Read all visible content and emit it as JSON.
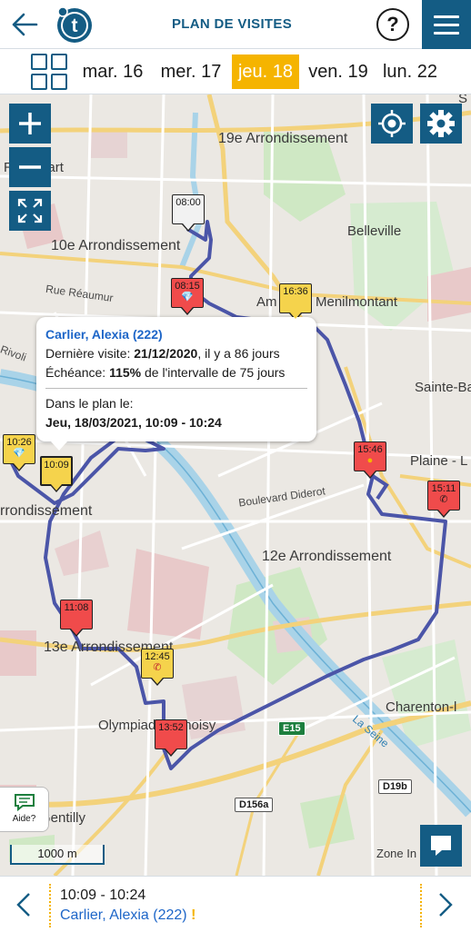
{
  "header": {
    "title": "PLAN DE VISITES",
    "help_label": "?",
    "logo_letter": "t"
  },
  "days": [
    {
      "label": "mar. 16",
      "active": false
    },
    {
      "label": "mer. 17",
      "active": false
    },
    {
      "label": "jeu. 18",
      "active": true
    },
    {
      "label": "ven. 19",
      "active": false
    },
    {
      "label": "lun. 22",
      "active": false
    }
  ],
  "map": {
    "places": {
      "p19e": "19e Arrondissement",
      "p10e": "10e Arrondissement",
      "belleville": "Belleville",
      "menilmontant": "Am  ers - Menilmontant",
      "reaumur": "Rue Réaumur",
      "sainte": "Sainte-Ba",
      "plaine": "Plaine - L",
      "rrond": "rrondissement",
      "diderot": "Boulevard Diderot",
      "p12e": "12e Arrondissement",
      "p13e": "13e Arrondissement",
      "olympiades": "Olympiades Choisy",
      "charenton": "Charenton-l",
      "seine": "La Seine",
      "gentilly": "Gentilly",
      "zone": "Zone In",
      "chouart": "R   houart",
      "rivoli": "Rivoli",
      "s_top": "S"
    },
    "shields": {
      "e15": "E15",
      "d19b": "D19b",
      "d156a": "D156a"
    },
    "markers": [
      {
        "time": "08:00",
        "color": "grey",
        "icon": ""
      },
      {
        "time": "08:15",
        "color": "red",
        "icon": "💎"
      },
      {
        "time": "16:36",
        "color": "yellow",
        "icon": ""
      },
      {
        "time": "15:46",
        "color": "red",
        "icon": "●"
      },
      {
        "time": "15:11",
        "color": "red",
        "icon": "✆"
      },
      {
        "time": "10:26",
        "color": "yellow",
        "icon": "💎"
      },
      {
        "time": "10:09",
        "color": "yellow",
        "icon": ""
      },
      {
        "time": "11:08",
        "color": "red",
        "icon": ""
      },
      {
        "time": "12:45",
        "color": "yellow",
        "icon": "✆"
      },
      {
        "time": "13:52",
        "color": "red",
        "icon": ""
      }
    ],
    "popup": {
      "name": "Carlier, Alexia (222)",
      "last_visit_label": "Dernière visite:",
      "last_visit_date": "21/12/2020",
      "last_visit_suffix": ", il y a 86 jours",
      "due_label": "Échéance:",
      "due_percent": "115%",
      "due_suffix": "de l'intervalle de 75 jours",
      "plan_label": "Dans le plan le:",
      "plan_value": "Jeu, 18/03/2021, 10:09 - 10:24"
    },
    "aide_label": "Aide?",
    "scale_label": "1000 m"
  },
  "footer": {
    "time": "10:09 - 10:24",
    "client": "Carlier, Alexia (222)",
    "warn": "!"
  },
  "colors": {
    "brand": "#145c84",
    "accent": "#f5b400",
    "route": "#4b55a8",
    "link": "#1e66c8"
  }
}
